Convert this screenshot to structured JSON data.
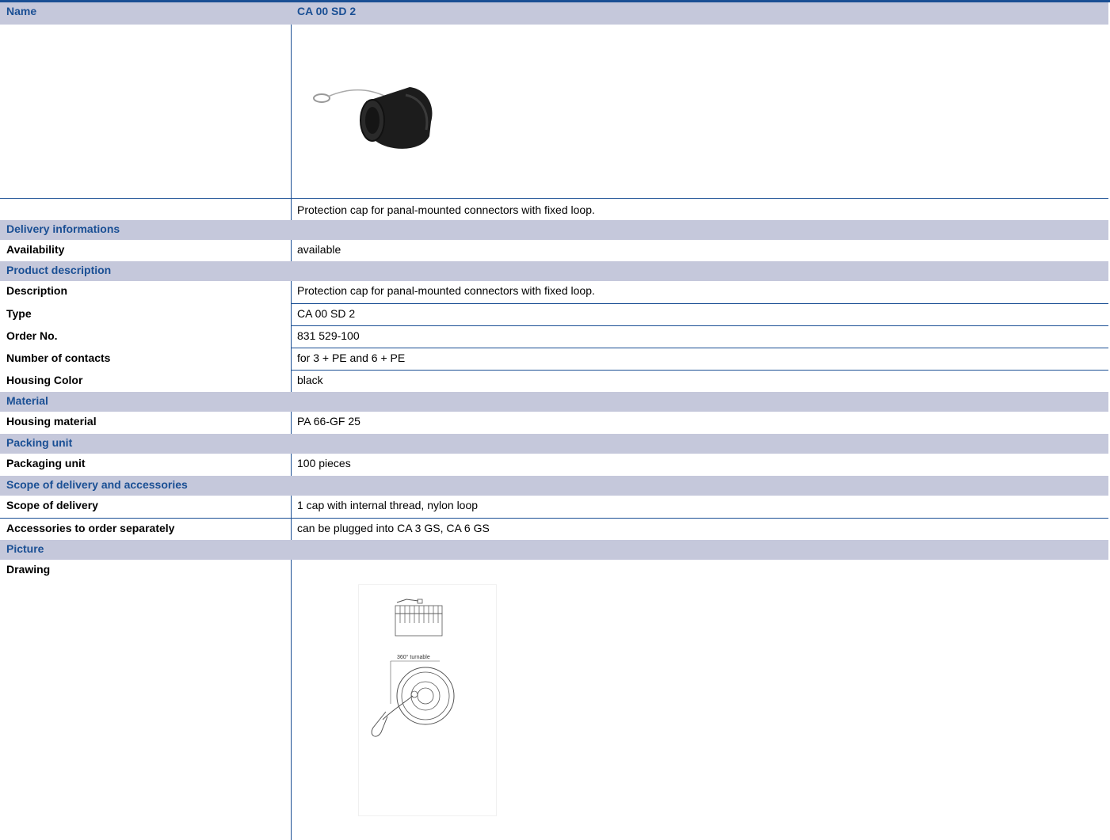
{
  "header": {
    "name_label": "Name",
    "name_value": "CA 00 SD 2"
  },
  "intro": {
    "description": "Protection cap for panal-mounted connectors with fixed loop."
  },
  "sections": {
    "delivery": {
      "title": "Delivery informations",
      "availability_label": "Availability",
      "availability_value": "available"
    },
    "product": {
      "title": "Product description",
      "description_label": "Description",
      "description_value": "Protection cap for panal-mounted connectors with fixed loop.",
      "type_label": "Type",
      "type_value": "CA 00 SD 2",
      "order_label": "Order No.",
      "order_value": "831 529-100",
      "contacts_label": "Number of contacts",
      "contacts_value": "for 3 + PE and 6 + PE",
      "color_label": "Housing Color",
      "color_value": "black"
    },
    "material": {
      "title": "Material",
      "housing_label": "Housing material",
      "housing_value": "PA 66-GF 25"
    },
    "packing": {
      "title": "Packing unit",
      "unit_label": "Packaging unit",
      "unit_value": "100 pieces"
    },
    "scope": {
      "title": "Scope of delivery and accessories",
      "scope_label": "Scope of delivery",
      "scope_value": "1 cap with internal thread, nylon loop",
      "acc_label": "Accessories to order separately",
      "acc_value": "can be plugged into CA 3 GS, CA 6 GS"
    },
    "picture": {
      "title": "Picture",
      "drawing_label": "Drawing",
      "drawing_annotation": "360° turnable"
    }
  },
  "colors": {
    "accent": "#1a4f94",
    "header_bg": "#c5c8db"
  },
  "icons": {
    "product_photo": "protection-cap-photo",
    "technical_drawing": "protection-cap-drawing"
  }
}
